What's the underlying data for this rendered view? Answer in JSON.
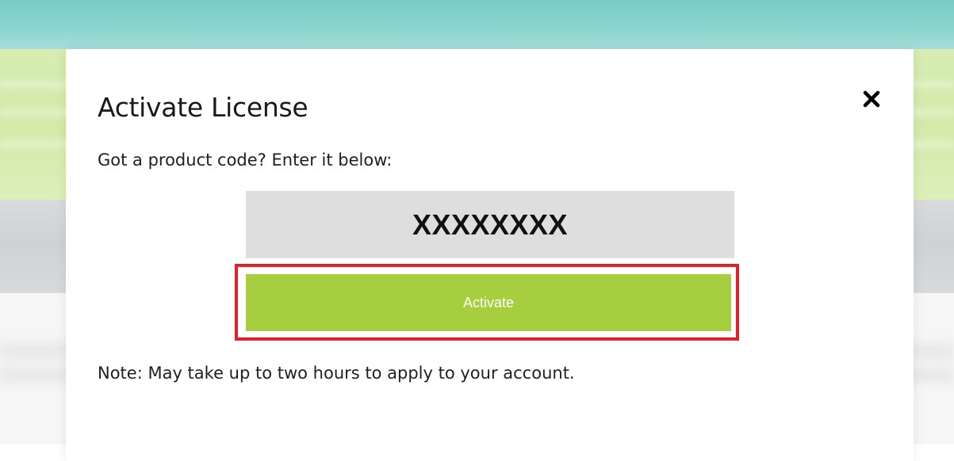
{
  "colors": {
    "background_teal": "#79cbc7",
    "background_green": "#d6ecb2",
    "background_gray": "#d3d5d8",
    "modal_bg": "#ffffff",
    "code_field_bg": "#dedede",
    "activate_button": "#a6ce3e",
    "highlight_border": "#e3202a",
    "text": "#1a1a1a"
  },
  "modal": {
    "title": "Activate License",
    "subtitle": "Got a product code? Enter it below:",
    "code_input": {
      "value": "XXXXXXXX"
    },
    "activate_button_label": "Activate",
    "note": "Note: May take up to two hours to apply to your account.",
    "close_icon": "close-icon"
  }
}
